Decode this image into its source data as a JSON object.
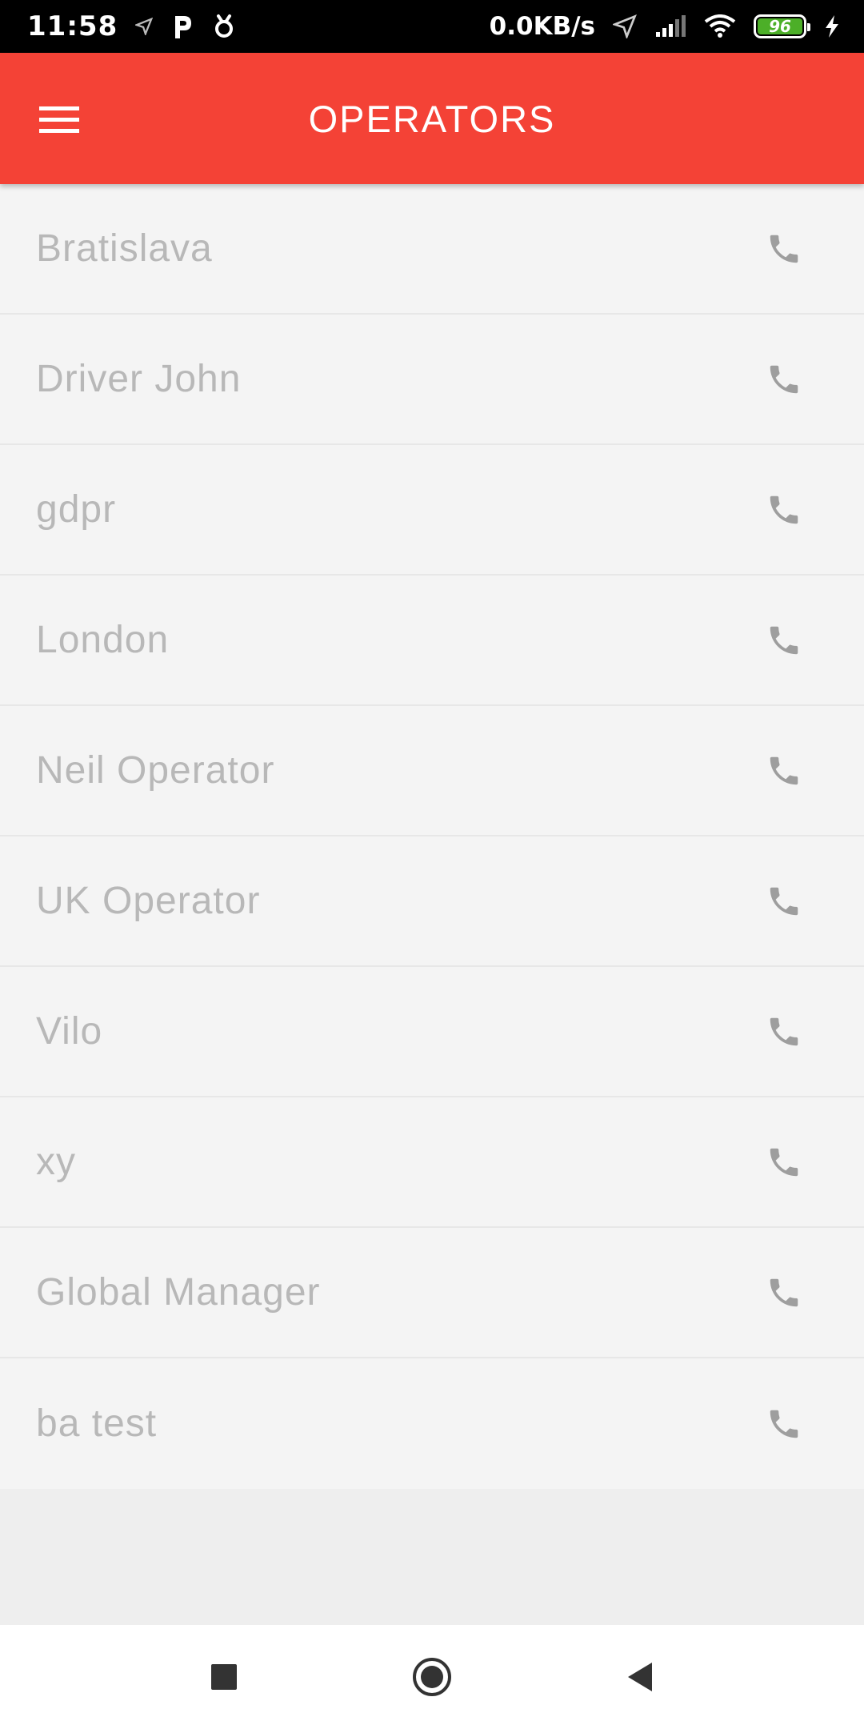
{
  "status_bar": {
    "time": "11:58",
    "network_speed": "0.0KB/s",
    "battery_level": "96",
    "icons": [
      "location-arrow-icon",
      "parking-icon",
      "notification-icon",
      "location-arrow-icon",
      "signal-icon",
      "wifi-icon",
      "battery-icon",
      "charging-icon"
    ]
  },
  "appbar": {
    "title": "OPERATORS",
    "color": "#f44236",
    "menu_icon": "hamburger-menu-icon"
  },
  "operators": [
    {
      "name": "Bratislava"
    },
    {
      "name": "Driver John"
    },
    {
      "name": "gdpr"
    },
    {
      "name": "London"
    },
    {
      "name": "Neil Operator"
    },
    {
      "name": "UK Operator"
    },
    {
      "name": "Vilo"
    },
    {
      "name": "xy"
    },
    {
      "name": "Global Manager"
    },
    {
      "name": "ba test"
    }
  ],
  "row_action_icon": "phone-icon",
  "nav_bar": {
    "buttons": [
      "recents-square-icon",
      "home-circle-icon",
      "back-triangle-icon"
    ]
  }
}
